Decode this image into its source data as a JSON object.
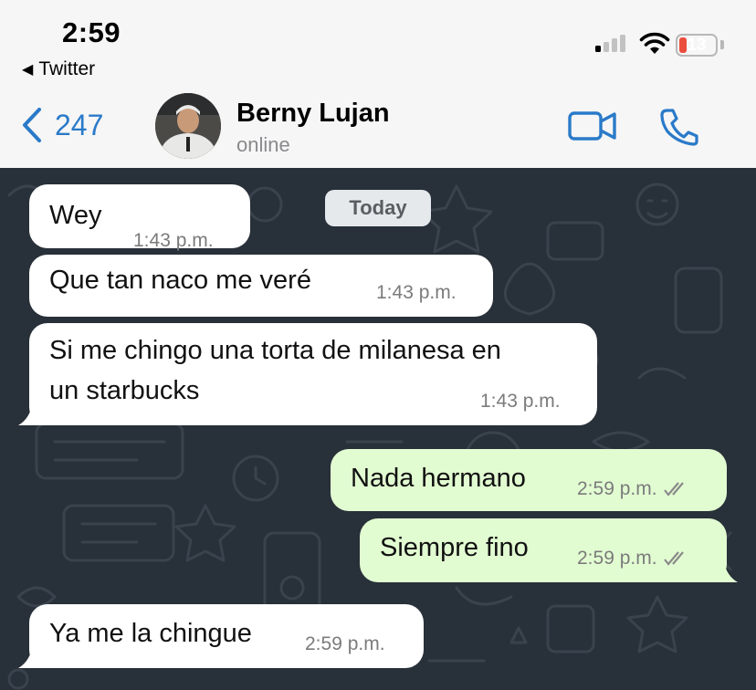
{
  "status_bar": {
    "time": "2:59",
    "back_app": "Twitter",
    "battery": "13",
    "icons": [
      "signal-icon",
      "wifi-icon",
      "battery-icon"
    ]
  },
  "header": {
    "back_count": "247",
    "contact_name": "Berny Lujan",
    "contact_status": "online",
    "icons": [
      "chevron-left-icon",
      "video-call-icon",
      "phone-icon"
    ]
  },
  "chat": {
    "date_chip": "Today",
    "messages": [
      {
        "direction": "in",
        "lines": [
          "Wey"
        ],
        "time": "1:43 p.m."
      },
      {
        "direction": "in",
        "lines": [
          "Que tan naco me veré"
        ],
        "time": "1:43 p.m."
      },
      {
        "direction": "in",
        "lines": [
          "Si me chingo una torta de milanesa en",
          "un starbucks"
        ],
        "time": "1:43 p.m."
      },
      {
        "direction": "out",
        "lines": [
          "Nada hermano"
        ],
        "time": "2:59 p.m.",
        "status": "read"
      },
      {
        "direction": "out",
        "lines": [
          "Siempre fino"
        ],
        "time": "2:59 p.m.",
        "status": "read"
      },
      {
        "direction": "in",
        "lines": [
          "Ya me la chingue"
        ],
        "time": "2:59 p.m."
      }
    ]
  },
  "colors": {
    "accent": "#2a7ac9",
    "chat_background": "#283039",
    "incoming_bubble": "#ffffff",
    "outgoing_bubble": "#e2fcd2",
    "battery_low": "#eb4d3d"
  }
}
